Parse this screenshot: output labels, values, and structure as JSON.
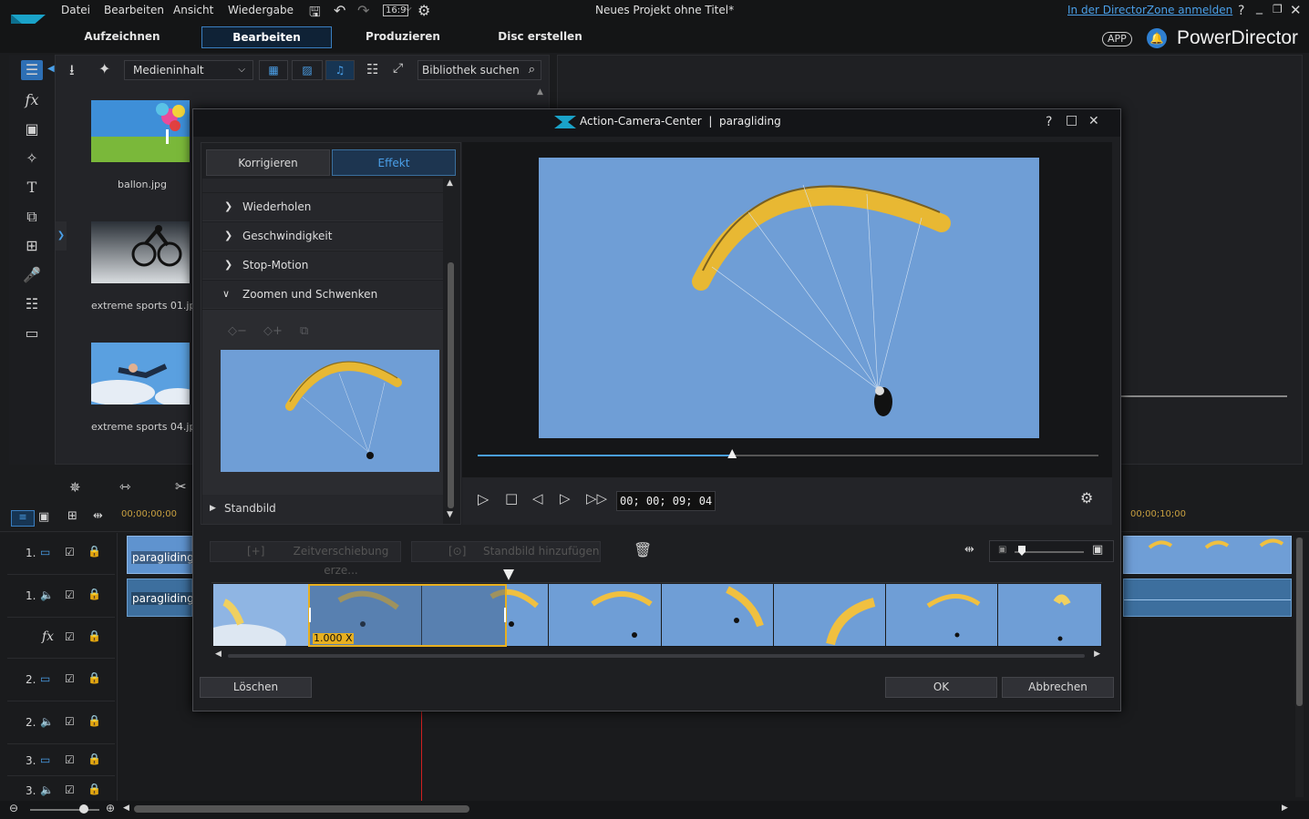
{
  "menu": {
    "items": [
      "Datei",
      "Bearbeiten",
      "Ansicht",
      "Wiedergabe"
    ],
    "aspect": "16:9",
    "project_title": "Neues Projekt ohne Titel*",
    "login_link": "In der DirectorZone anmelden",
    "help": "?"
  },
  "modes": {
    "capture": "Aufzeichnen",
    "edit": "Bearbeiten",
    "produce": "Produzieren",
    "disc": "Disc erstellen"
  },
  "brand": {
    "app_badge": "APP",
    "name": "PowerDirector"
  },
  "library": {
    "filter_value": "Medieninhalt",
    "search_placeholder": "Bibliothek suchen",
    "items": [
      {
        "name": "ballon.jpg"
      },
      {
        "name": "extreme sports 01.jp"
      },
      {
        "name": "extreme sports 04.jp"
      }
    ]
  },
  "timeline": {
    "ruler_start": "00;00;00;00",
    "ruler_end": "00;00;10;00",
    "tracks": [
      {
        "num": "1.",
        "clip": "paragliding"
      },
      {
        "num": "1.",
        "clip": "paragliding"
      },
      {
        "num": "fx",
        "clip": ""
      },
      {
        "num": "2.",
        "clip": ""
      },
      {
        "num": "2.",
        "clip": ""
      },
      {
        "num": "3.",
        "clip": ""
      },
      {
        "num": "3.",
        "clip": ""
      }
    ]
  },
  "dialog": {
    "title": "Action-Camera-Center  |  paragliding",
    "tab_correct": "Korrigieren",
    "tab_effect": "Effekt",
    "sections": [
      "Wiederholen",
      "Geschwindigkeit",
      "Stop-Motion",
      "Zoomen und Schwenken"
    ],
    "freeze": "Standbild",
    "timecode": "00; 00; 09; 04",
    "playback_progress": 0.41,
    "time_shift": "Zeitverschiebung erze...",
    "add_freeze": "Standbild hinzufügen",
    "speed_label": "1.000 X",
    "delete": "Löschen",
    "ok": "OK",
    "cancel": "Abbrechen"
  },
  "colors": {
    "accent": "#3a7fc1",
    "sky": "#6f9ed6",
    "wing": "#f0c040",
    "selection": "#e8b020"
  }
}
